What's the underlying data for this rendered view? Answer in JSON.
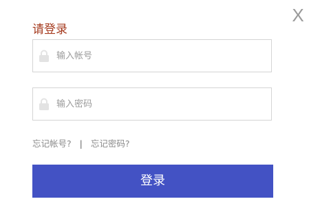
{
  "dialog": {
    "title": "请登录",
    "close_label": "X"
  },
  "account": {
    "icon": "lock-icon",
    "placeholder": "输入帐号",
    "value": ""
  },
  "password": {
    "icon": "lock-icon",
    "placeholder": "输入密码",
    "value": ""
  },
  "links": {
    "forgot_account": "忘记帐号?",
    "separator": "|",
    "forgot_password": "忘记密码?"
  },
  "login_button": {
    "label": "登录"
  },
  "colors": {
    "title": "#a53a1e",
    "button": "#4352c4",
    "border": "#d4d4d4",
    "placeholder": "#9b9b9b"
  }
}
